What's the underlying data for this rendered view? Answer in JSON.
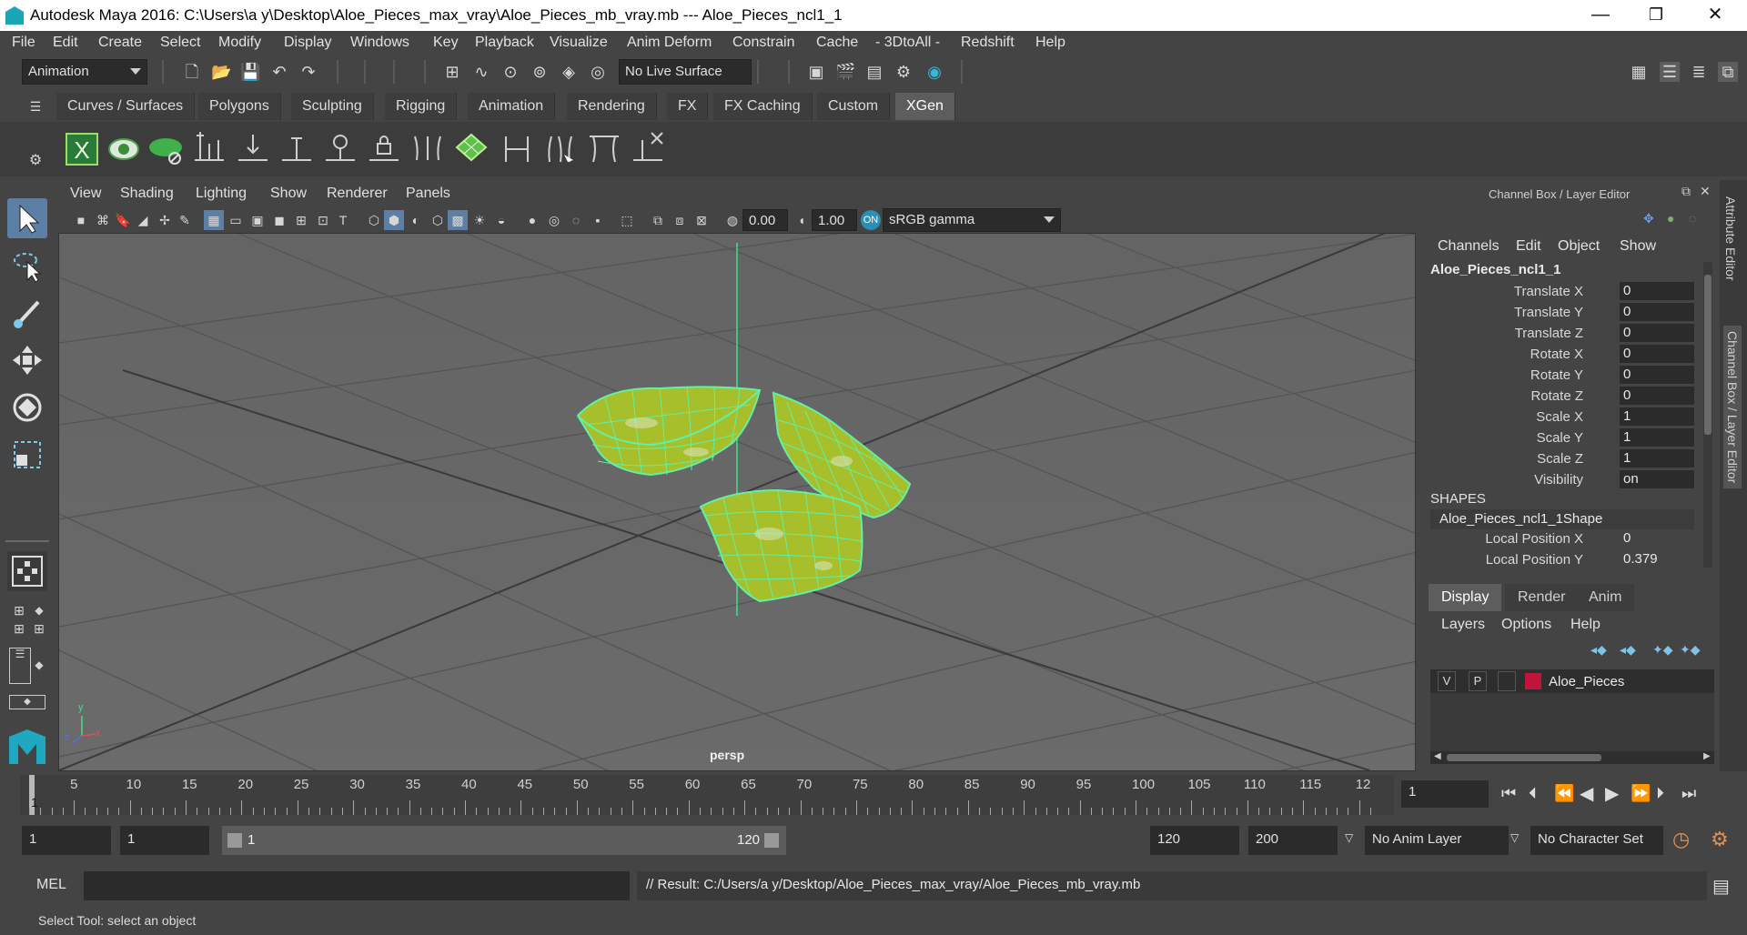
{
  "window": {
    "title": "Autodesk Maya 2016: C:\\Users\\a y\\Desktop\\Aloe_Pieces_max_vray\\Aloe_Pieces_mb_vray.mb   ---   Aloe_Pieces_ncl1_1",
    "minimize": "—",
    "maximize": "❐",
    "close": "✕"
  },
  "menubar": [
    "File",
    "Edit",
    "Create",
    "Select",
    "Modify",
    "Display",
    "Windows",
    "Key",
    "Playback",
    "Visualize",
    "Anim Deform",
    "Constrain",
    "Cache",
    "- 3DtoAll -",
    "Redshift",
    "Help"
  ],
  "statusline": {
    "mode": "Animation",
    "live_surface": "No Live Surface"
  },
  "shelf": {
    "tabs": [
      "Curves / Surfaces",
      "Polygons",
      "Sculpting",
      "Rigging",
      "Animation",
      "Rendering",
      "FX",
      "FX Caching",
      "Custom",
      "XGen"
    ],
    "active_tab": "XGen"
  },
  "viewport": {
    "menu": [
      "View",
      "Shading",
      "Lighting",
      "Show",
      "Renderer",
      "Panels"
    ],
    "exposure": "0.00",
    "gamma": "1.00",
    "color_space": "sRGB gamma",
    "camera_label": "persp",
    "axis_x": "x",
    "axis_y": "y",
    "axis_z": "z"
  },
  "channel_box": {
    "header": "Channel Box / Layer Editor",
    "menu": [
      "Channels",
      "Edit",
      "Object",
      "Show"
    ],
    "object_name": "Aloe_Pieces_ncl1_1",
    "attributes": [
      {
        "label": "Translate X",
        "value": "0"
      },
      {
        "label": "Translate Y",
        "value": "0"
      },
      {
        "label": "Translate Z",
        "value": "0"
      },
      {
        "label": "Rotate X",
        "value": "0"
      },
      {
        "label": "Rotate Y",
        "value": "0"
      },
      {
        "label": "Rotate Z",
        "value": "0"
      },
      {
        "label": "Scale X",
        "value": "1"
      },
      {
        "label": "Scale Y",
        "value": "1"
      },
      {
        "label": "Scale Z",
        "value": "1"
      },
      {
        "label": "Visibility",
        "value": "on"
      }
    ],
    "shapes_header": "SHAPES",
    "shape_name": "Aloe_Pieces_ncl1_1Shape",
    "shape_attributes": [
      {
        "label": "Local Position X",
        "value": "0"
      },
      {
        "label": "Local Position Y",
        "value": "0.379"
      }
    ],
    "side_tabs": [
      "Attribute Editor",
      "Channel Box / Layer Editor"
    ]
  },
  "layer_editor": {
    "tabs": [
      "Display",
      "Render",
      "Anim"
    ],
    "active_tab": "Display",
    "menu": [
      "Layers",
      "Options",
      "Help"
    ],
    "layers": [
      {
        "v": "V",
        "p": "P",
        "color": "#c0143c",
        "name": "Aloe_Pieces"
      }
    ]
  },
  "timeline": {
    "ticks": [
      "5",
      "10",
      "15",
      "20",
      "25",
      "30",
      "35",
      "40",
      "45",
      "50",
      "55",
      "60",
      "65",
      "70",
      "75",
      "80",
      "85",
      "90",
      "95",
      "100",
      "105",
      "110",
      "115",
      "12"
    ],
    "current_marker": "1",
    "current_frame": "1"
  },
  "range": {
    "start": "1",
    "anim_start": "1",
    "range_start": "1",
    "range_end": "120",
    "end": "120",
    "anim_end": "200",
    "anim_layer": "No Anim Layer",
    "character_set": "No Character Set"
  },
  "command": {
    "mode": "MEL",
    "result": "// Result: C:/Users/a y/Desktop/Aloe_Pieces_max_vray/Aloe_Pieces_mb_vray.mb"
  },
  "help_line": "Select Tool: select an object"
}
